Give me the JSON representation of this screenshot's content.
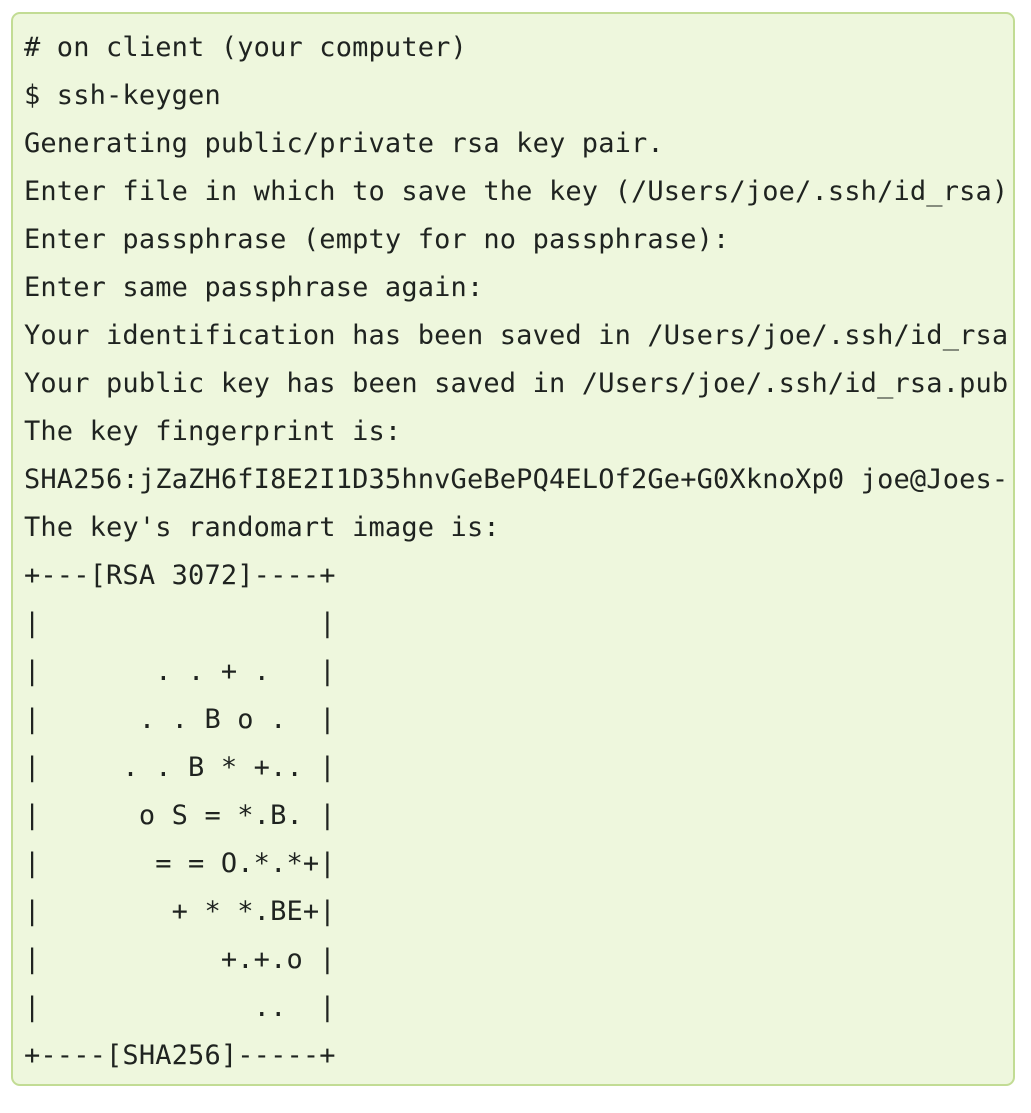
{
  "code_block": {
    "lines": [
      "# on client (your computer)",
      "$ ssh-keygen",
      "Generating public/private rsa key pair.",
      "Enter file in which to save the key (/Users/joe/.ssh/id_rsa):",
      "Enter passphrase (empty for no passphrase):",
      "Enter same passphrase again:",
      "Your identification has been saved in /Users/joe/.ssh/id_rsa",
      "Your public key has been saved in /Users/joe/.ssh/id_rsa.pub",
      "The key fingerprint is:",
      "SHA256:jZaZH6fI8E2I1D35hnvGeBePQ4ELOf2Ge+G0XknoXp0 joe@Joes-",
      "The key's randomart image is:",
      "+---[RSA 3072]----+",
      "|                 |",
      "|       . . + .   |",
      "|      . . B o .  |",
      "|     . . B * +.. |",
      "|      o S = *.B. |",
      "|       = = O.*.*+|",
      "|        + * *.BE+|",
      "|           +.+.o |",
      "|             ..  |",
      "+----[SHA256]-----+"
    ]
  }
}
